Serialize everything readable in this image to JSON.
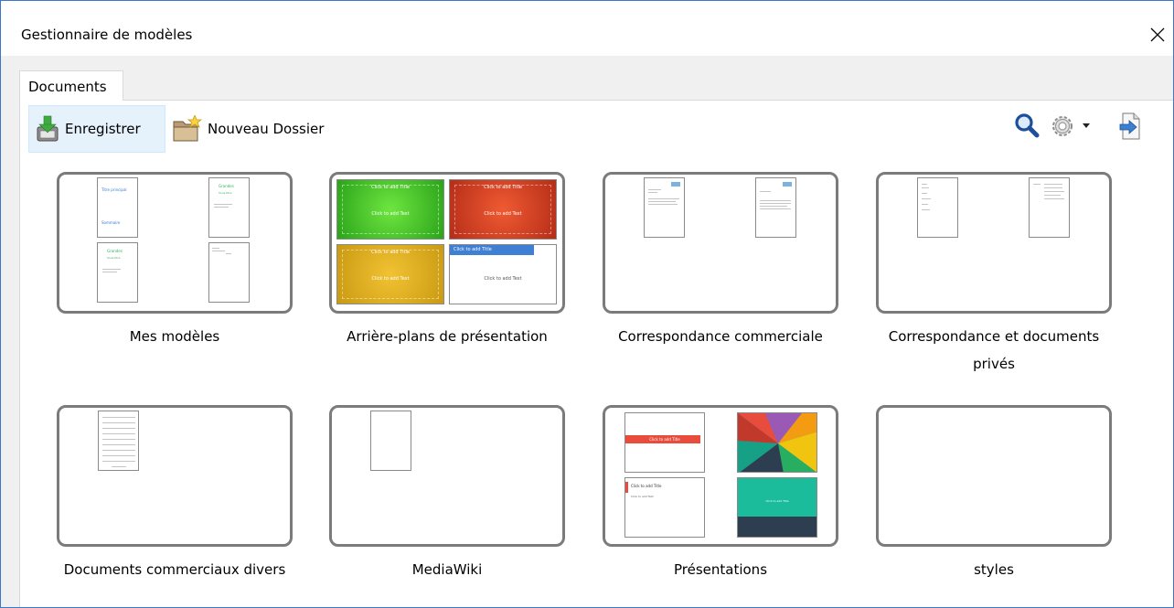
{
  "window": {
    "title": "Gestionnaire de modèles"
  },
  "tabs": [
    {
      "label": "Documents",
      "selected": true
    }
  ],
  "toolbar": {
    "save_label": "Enregistrer",
    "new_folder_label": "Nouveau Dossier",
    "icons": [
      "save-icon",
      "new-folder-icon",
      "search-icon",
      "gear-icon",
      "dropdown-arrow-icon",
      "import-icon"
    ]
  },
  "folders": [
    {
      "label": "Mes modèles"
    },
    {
      "label": "Arrière-plans de présentation"
    },
    {
      "label": "Correspondance commerciale"
    },
    {
      "label": "Correspondance et documents privés"
    },
    {
      "label": "Documents commerciaux divers"
    },
    {
      "label": "MediaWiki"
    },
    {
      "label": "Présentations"
    },
    {
      "label": "styles"
    }
  ],
  "thumbnails": {
    "mes_modeles": {
      "doc1_heading": "Titre principal",
      "doc1_text": "Sommaire",
      "doc2_heading": "Grandes",
      "doc2_sub": "Sous-titre",
      "doc3_heading": "Grandes",
      "doc3_sub": "Sous-titre"
    },
    "backgrounds": {
      "title_text": "Click to add Title",
      "body_text": "Click to add Text"
    },
    "presentations": {
      "title_text": "Click to add Title",
      "body_text": "Click to add Text"
    }
  },
  "colors": {
    "accent_border": "#3c78c8",
    "save_button_bg": "#e5f1fb",
    "tile_border": "#7b7b7b",
    "bg_green": "#4bc42a",
    "bg_red": "#d83a22",
    "bg_yellow": "#e5b01c",
    "bg_blue_bar": "#3f7fd4",
    "pres_red": "#e74c3c",
    "pres_teal": "#1abc9c",
    "pres_navy": "#2c3e50"
  }
}
